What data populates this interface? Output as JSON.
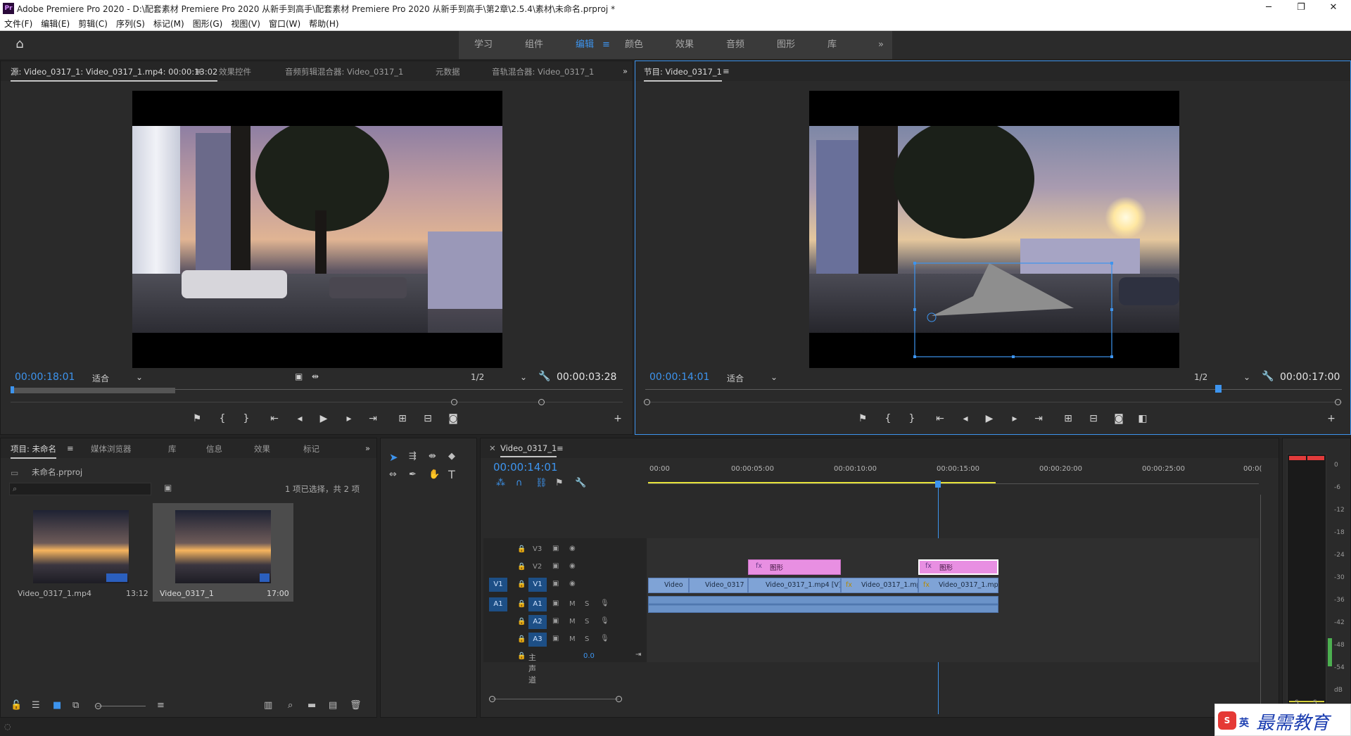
{
  "window": {
    "title": "Adobe Premiere Pro 2020 - D:\\配套素材 Premiere Pro 2020 从新手到高手\\配套素材 Premiere Pro 2020 从新手到高手\\第2章\\2.5.4\\素材\\未命名.prproj *",
    "logo": "Pr",
    "minimize": "─",
    "restore": "❐",
    "close": "✕"
  },
  "menu": [
    "文件(F)",
    "编辑(E)",
    "剪辑(C)",
    "序列(S)",
    "标记(M)",
    "图形(G)",
    "视图(V)",
    "窗口(W)",
    "帮助(H)"
  ],
  "workspaces": {
    "tabs": [
      "学习",
      "组件",
      "编辑",
      "颜色",
      "效果",
      "音频",
      "图形",
      "库"
    ],
    "active": "编辑",
    "menu_icon": "≡",
    "more": "»"
  },
  "source_panel": {
    "tabs": [
      "源: Video_0317_1: Video_0317_1.mp4: 00:00:13:02",
      "效果控件",
      "音频剪辑混合器: Video_0317_1",
      "元数据",
      "音轨混合器: Video_0317_1"
    ],
    "timecode": "00:00:18:01",
    "fit": "适合",
    "resolution": "1/2",
    "duration": "00:00:03:28"
  },
  "program_panel": {
    "tab": "节目: Video_0317_1",
    "timecode": "00:00:14:01",
    "fit": "适合",
    "resolution": "1/2",
    "duration": "00:00:17:00"
  },
  "project_panel": {
    "tabs": [
      "项目: 未命名",
      "媒体浏览器",
      "库",
      "信息",
      "效果",
      "标记"
    ],
    "project_file": "未命名.prproj",
    "selection_info": "1 项已选择，共 2 项",
    "items": [
      {
        "name": "Video_0317_1.mp4",
        "duration": "13:12"
      },
      {
        "name": "Video_0317_1",
        "duration": "17:00"
      }
    ]
  },
  "timeline": {
    "tab": "Video_0317_1",
    "timecode": "00:00:14:01",
    "ruler": [
      "00:00",
      "00:00:05:00",
      "00:00:10:00",
      "00:00:15:00",
      "00:00:20:00",
      "00:00:25:00",
      "00:0("
    ],
    "video_tracks": [
      {
        "name": "V3",
        "source": ""
      },
      {
        "name": "V2",
        "source": ""
      },
      {
        "name": "V1",
        "source": "V1"
      }
    ],
    "audio_tracks": [
      {
        "name": "A1",
        "source": "A1",
        "m": "M",
        "s": "S"
      },
      {
        "name": "A2",
        "m": "M",
        "s": "S"
      },
      {
        "name": "A3",
        "m": "M",
        "s": "S"
      }
    ],
    "master": {
      "label": "主声道",
      "value": "0.0"
    },
    "clips_v2": [
      "图形",
      "图形"
    ],
    "clips_v1": [
      "Video",
      "Video_0317",
      "Video_0317_1.mp4 [V]",
      "Video_0317_1.mp",
      "Video_0317_1.mp4 ["
    ],
    "fx": "fx"
  },
  "meter": {
    "labels": [
      "0",
      "-6",
      "-12",
      "-18",
      "-24",
      "-30",
      "-36",
      "-42",
      "-48",
      "-54",
      "dB"
    ],
    "channels": [
      "S",
      "S"
    ]
  },
  "watermark": {
    "text": "最需教育",
    "lang": "英"
  },
  "colors": {
    "accent": "#3d94ee",
    "graphic_clip": "#e88fe2",
    "video_clip": "#7fa3d6"
  }
}
